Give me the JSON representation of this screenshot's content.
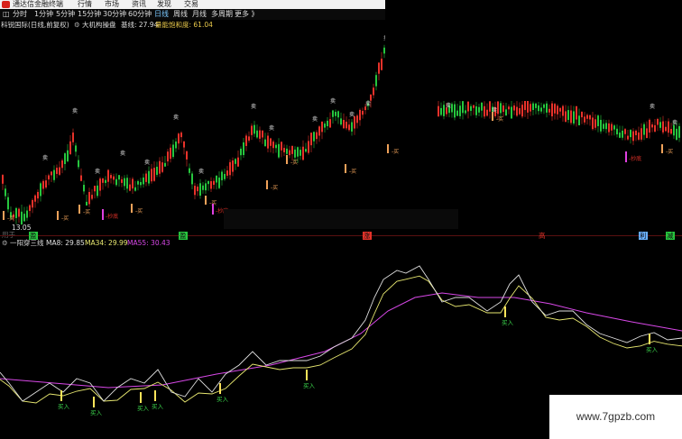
{
  "app": {
    "title": "通达信金融终端",
    "menus": [
      "行情",
      "市场",
      "资讯",
      "发现",
      "交易"
    ]
  },
  "periods": {
    "items": [
      "分时",
      "1分钟",
      "5分钟",
      "15分钟",
      "30分钟",
      "60分钟",
      "日线",
      "周线",
      "月线",
      "多周期",
      "更多 》"
    ],
    "active": "日线"
  },
  "main_chart": {
    "stock": "科锐国际(日线,前复权)",
    "indicator_name": "大机构操盘",
    "base_label": "基线: 27.94",
    "sat_label": "量能饱和度: 61.04",
    "low_price": "13.05",
    "buy_label": "买",
    "sell_label": "卖",
    "copy_label": "抄底",
    "footer": "用于",
    "bottom_marks": [
      "盈",
      "涨",
      "高",
      "利",
      "减"
    ]
  },
  "sub_chart": {
    "indicator_name": "一阳穿三线",
    "ma8": "MA8: 29.85",
    "ma34": "MA34: 29.99",
    "ma55": "MA55: 30.43",
    "buy_label": "买入"
  },
  "colors": {
    "up": "#e8332a",
    "down": "#27c63e",
    "buy": "#f0a25a",
    "ma8_line": "#e0e0e0",
    "ma34_line": "#e8e870",
    "ma55_line": "#d848e8",
    "signal": "#ffe45a",
    "copy_bottom": "#e040e0"
  },
  "watermark": "www.7gpzb.com"
}
